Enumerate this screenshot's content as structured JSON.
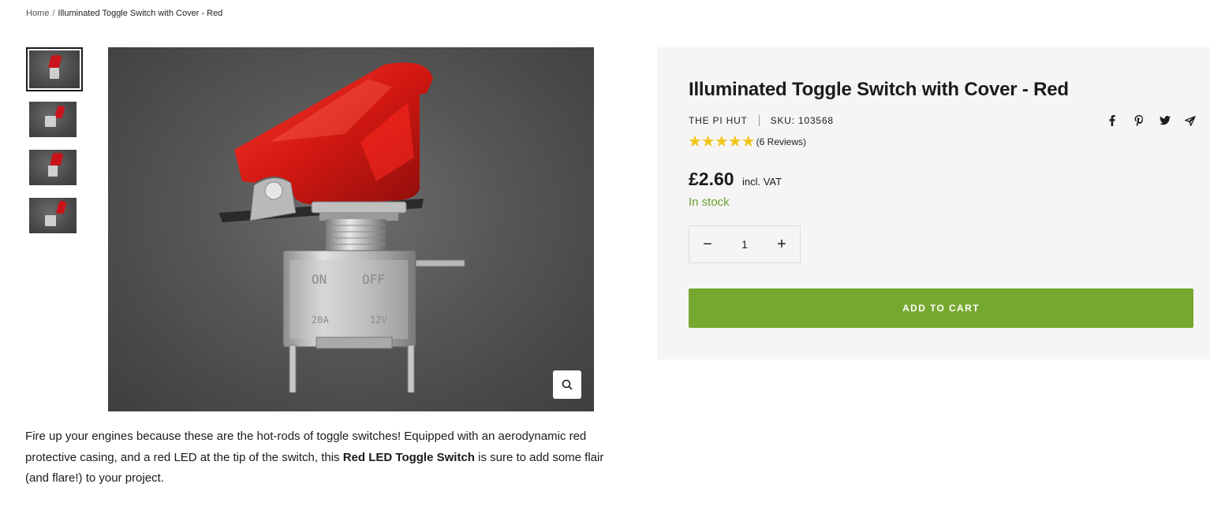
{
  "breadcrumb": {
    "home": "Home",
    "separator": "/",
    "current": "Illuminated Toggle Switch with Cover - Red"
  },
  "gallery": {
    "thumbnail_count": 4,
    "active_index": 0,
    "switch_labels": {
      "on": "ON",
      "off": "OFF",
      "amps": "20A",
      "volts": "12V"
    },
    "zoom_icon": "magnifier-icon"
  },
  "description": {
    "part1": "Fire up your engines because these are the hot-rods of toggle switches! Equipped with an aerodynamic red protective casing, and a red LED at the tip of the switch, this ",
    "bold": "Red LED Toggle Switch",
    "part2": " is sure to add some flair (and flare!) to your project."
  },
  "product": {
    "title": "Illuminated Toggle Switch with Cover - Red",
    "vendor": "THE PI HUT",
    "sku": "SKU: 103568",
    "rating": 5,
    "stars": "★★★★★",
    "reviews": "(6 Reviews)",
    "price": "£2.60",
    "vat": "incl. VAT",
    "stock": "In stock",
    "quantity": "1",
    "qty_minus": "−",
    "qty_plus": "+",
    "add_to_cart": "ADD TO CART"
  },
  "share_icons": [
    "facebook-icon",
    "pinterest-icon",
    "twitter-icon",
    "send-icon"
  ],
  "colors": {
    "accent_green": "#76a72f",
    "stock_green": "#6a9f2d",
    "panel_bg": "#f5f5f5",
    "star_yellow": "#f0c419",
    "switch_red": "#c8141a"
  }
}
